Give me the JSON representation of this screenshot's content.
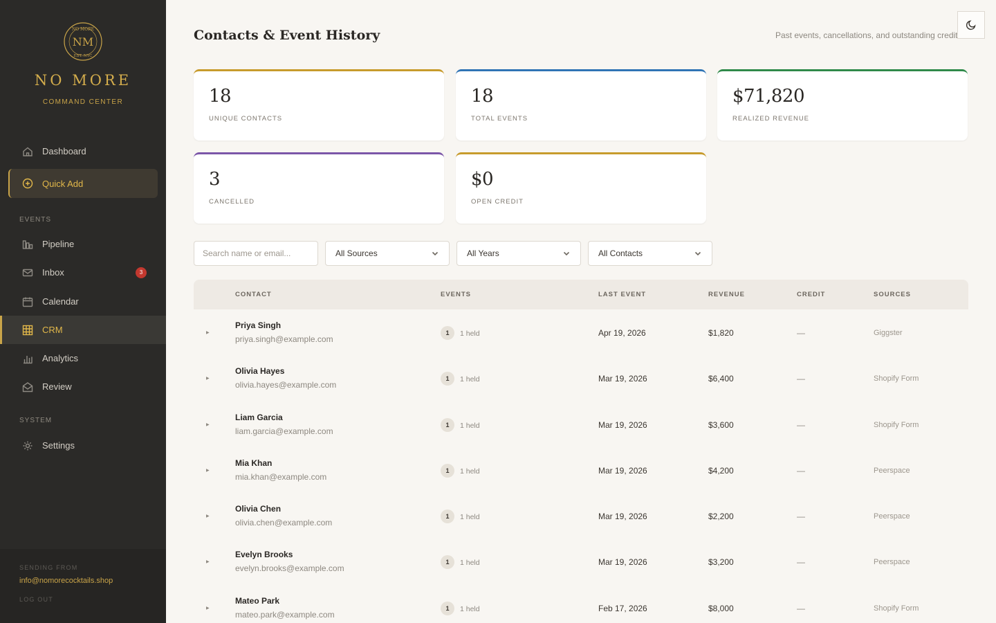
{
  "brand": {
    "seal_text_top": "NO MORE",
    "seal_monogram": "NM",
    "seal_text_bottom": "EST. NYC",
    "name": "NO MORE",
    "subtitle": "COMMAND CENTER"
  },
  "nav": {
    "dashboard": "Dashboard",
    "quick_add": "Quick Add",
    "section_events": "EVENTS",
    "pipeline": "Pipeline",
    "inbox": "Inbox",
    "inbox_badge": "3",
    "calendar": "Calendar",
    "crm": "CRM",
    "analytics": "Analytics",
    "review": "Review",
    "section_system": "SYSTEM",
    "settings": "Settings"
  },
  "footer": {
    "sending_label": "SENDING FROM",
    "email": "info@nomorecocktails.shop",
    "logout": "LOG OUT"
  },
  "header": {
    "title": "Contacts & Event History",
    "subtitle": "Past events, cancellations, and outstanding credit"
  },
  "stats": {
    "unique_contacts": {
      "value": "18",
      "label": "UNIQUE CONTACTS",
      "color": "#c79b2c"
    },
    "total_events": {
      "value": "18",
      "label": "TOTAL EVENTS",
      "color": "#2f74b5"
    },
    "realized_revenue": {
      "value": "$71,820",
      "label": "REALIZED REVENUE",
      "color": "#2f8a4a"
    },
    "cancelled": {
      "value": "3",
      "label": "CANCELLED",
      "color": "#7b56a8"
    },
    "open_credit": {
      "value": "$0",
      "label": "OPEN CREDIT",
      "color": "#c79b2c"
    }
  },
  "filters": {
    "search_placeholder": "Search name or email...",
    "sources": "All Sources",
    "years": "All Years",
    "contacts": "All Contacts"
  },
  "table": {
    "headers": {
      "contact": "CONTACT",
      "events": "EVENTS",
      "last_event": "LAST EVENT",
      "revenue": "REVENUE",
      "credit": "CREDIT",
      "sources": "SOURCES"
    },
    "rows": [
      {
        "name": "Priya Singh",
        "email": "priya.singh@example.com",
        "events": "1",
        "held": "1 held",
        "last_event": "Apr 19, 2026",
        "revenue": "$1,820",
        "credit": "—",
        "source": "Giggster"
      },
      {
        "name": "Olivia Hayes",
        "email": "olivia.hayes@example.com",
        "events": "1",
        "held": "1 held",
        "last_event": "Mar 19, 2026",
        "revenue": "$6,400",
        "credit": "—",
        "source": "Shopify Form"
      },
      {
        "name": "Liam Garcia",
        "email": "liam.garcia@example.com",
        "events": "1",
        "held": "1 held",
        "last_event": "Mar 19, 2026",
        "revenue": "$3,600",
        "credit": "—",
        "source": "Shopify Form"
      },
      {
        "name": "Mia Khan",
        "email": "mia.khan@example.com",
        "events": "1",
        "held": "1 held",
        "last_event": "Mar 19, 2026",
        "revenue": "$4,200",
        "credit": "—",
        "source": "Peerspace"
      },
      {
        "name": "Olivia Chen",
        "email": "olivia.chen@example.com",
        "events": "1",
        "held": "1 held",
        "last_event": "Mar 19, 2026",
        "revenue": "$2,200",
        "credit": "—",
        "source": "Peerspace"
      },
      {
        "name": "Evelyn Brooks",
        "email": "evelyn.brooks@example.com",
        "events": "1",
        "held": "1 held",
        "last_event": "Mar 19, 2026",
        "revenue": "$3,200",
        "credit": "—",
        "source": "Peerspace"
      },
      {
        "name": "Mateo Park",
        "email": "mateo.park@example.com",
        "events": "1",
        "held": "1 held",
        "last_event": "Feb 17, 2026",
        "revenue": "$8,000",
        "credit": "—",
        "source": "Shopify Form"
      }
    ]
  }
}
